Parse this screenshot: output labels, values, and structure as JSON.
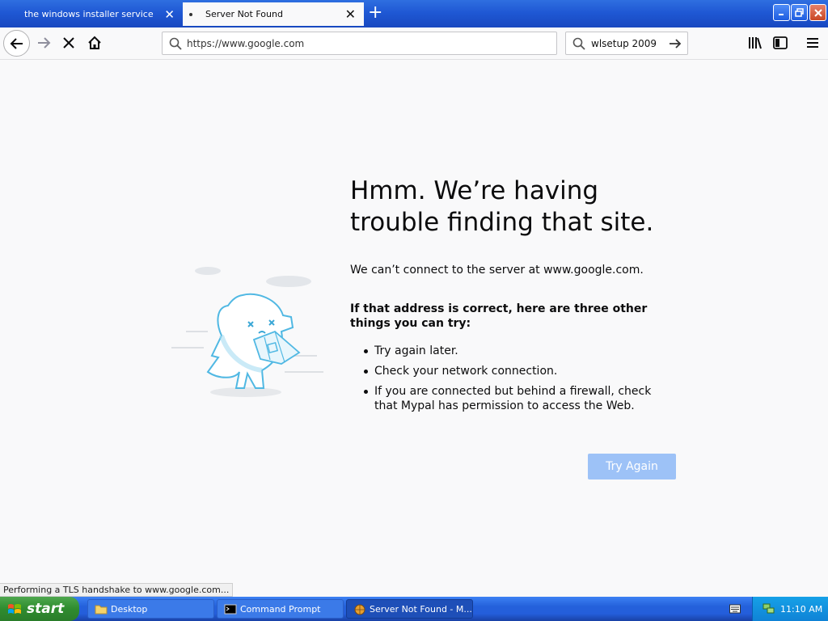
{
  "tabs": [
    {
      "title": "the windows installer service could not be accessed",
      "active": false
    },
    {
      "title": "Server Not Found",
      "active": true
    }
  ],
  "window_controls": {
    "minimize": "minimize",
    "maximize": "restore",
    "close": "close"
  },
  "navbar": {
    "url": "https://www.google.com",
    "search_value": "wlsetup 2009"
  },
  "error_page": {
    "title": "Hmm. We’re having trouble finding that site.",
    "description": "We can’t connect to the server at www.google.com.",
    "tips_heading": "If that address is correct, here are three other things you can try:",
    "tips": [
      "Try again later.",
      "Check your network connection.",
      "If you are connected but behind a firewall, check that Mypal has permission to access the Web."
    ],
    "try_again_label": "Try Again"
  },
  "status_text": "Performing a TLS handshake to www.google.com...",
  "taskbar": {
    "start_label": "start",
    "tasks": [
      {
        "label": "Desktop",
        "icon": "folder-icon"
      },
      {
        "label": "Command Prompt",
        "icon": "command-prompt-icon"
      },
      {
        "label": "Server Not Found - M...",
        "icon": "browser-icon"
      }
    ],
    "clock": "11:10 AM"
  },
  "colors": {
    "titlebar": "#1f58d4",
    "try_again_button": "#9dc2f7",
    "taskbar": "#245edb",
    "start_button": "#2f8c2f"
  }
}
